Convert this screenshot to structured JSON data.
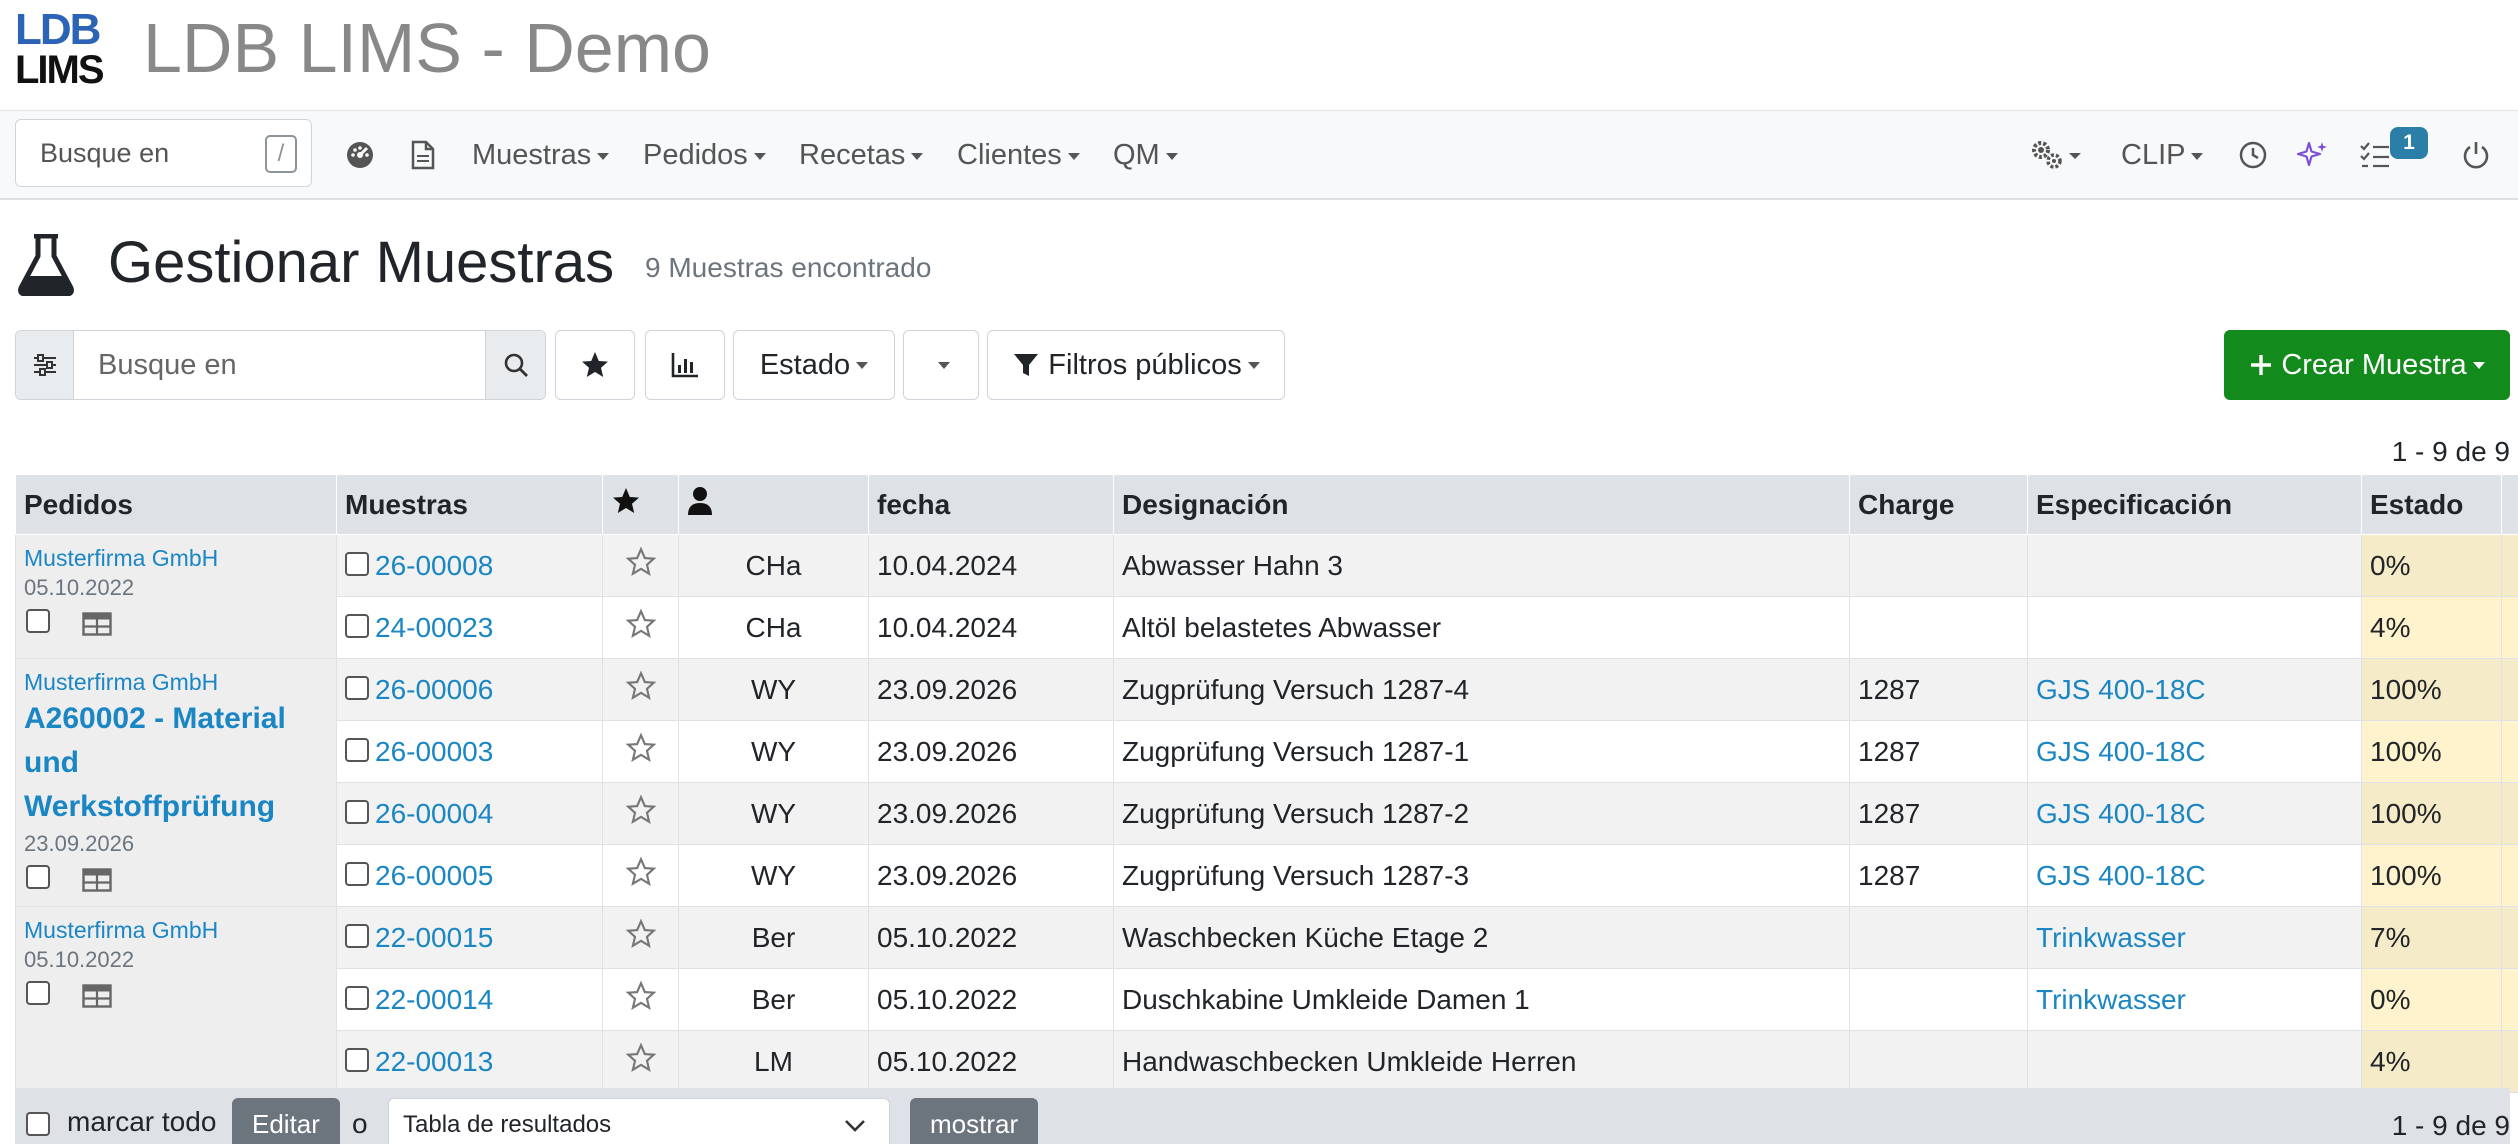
{
  "header": {
    "logo_line1": "LDB",
    "logo_line2": "LIMS",
    "title": "LDB LIMS - Demo"
  },
  "navbar": {
    "search_placeholder": "Busque en",
    "search_shortcut": "/",
    "menus": [
      "Muestras",
      "Pedidos",
      "Recetas",
      "Clientes",
      "QM"
    ],
    "right_menu": "CLIP",
    "tasks_badge": "1"
  },
  "page": {
    "title": "Gestionar Muestras",
    "count": "9 Muestras encontrado"
  },
  "toolbar": {
    "search_placeholder": "Busque en",
    "estado_label": "Estado",
    "public_filters_label": "Filtros públicos",
    "create_label": "Crear Muestra"
  },
  "pager": {
    "top": "1 - 9 de 9",
    "bottom": "1 - 9 de 9"
  },
  "table": {
    "columns": [
      "Pedidos",
      "Muestras",
      "",
      "",
      "fecha",
      "Designación",
      "Charge",
      "Especificación",
      "Estado",
      ""
    ],
    "groups": [
      {
        "client": "Musterfirma GmbH",
        "title": "",
        "date": "05.10.2022"
      },
      {
        "client": "Musterfirma GmbH",
        "title": "A260002 - Material und Werkstoffprüfung",
        "date": "23.09.2026"
      },
      {
        "client": "Musterfirma GmbH",
        "title": "",
        "date": "05.10.2022"
      }
    ],
    "rows": [
      {
        "id": "26-00008",
        "user": "CHa",
        "date": "10.04.2024",
        "designation": "Abwasser Hahn 3",
        "charge": "",
        "spec": "",
        "state": "0%",
        "icon": "truck-icon"
      },
      {
        "id": "24-00023",
        "user": "CHa",
        "date": "10.04.2024",
        "designation": "Altöl belastetes Abwasser",
        "charge": "",
        "spec": "",
        "state": "4%",
        "icon": "truck-icon"
      },
      {
        "id": "26-00006",
        "user": "WY",
        "date": "23.09.2026",
        "designation": "Zugprüfung Versuch 1287-4",
        "charge": "1287",
        "spec": "GJS 400-18C",
        "state": "100%",
        "icon": "report-icon"
      },
      {
        "id": "26-00003",
        "user": "WY",
        "date": "23.09.2026",
        "designation": "Zugprüfung Versuch 1287-1",
        "charge": "1287",
        "spec": "GJS 400-18C",
        "state": "100%",
        "icon": "report-icon"
      },
      {
        "id": "26-00004",
        "user": "WY",
        "date": "23.09.2026",
        "designation": "Zugprüfung Versuch 1287-2",
        "charge": "1287",
        "spec": "GJS 400-18C",
        "state": "100%",
        "icon": "report-icon"
      },
      {
        "id": "26-00005",
        "user": "WY",
        "date": "23.09.2026",
        "designation": "Zugprüfung Versuch 1287-3",
        "charge": "1287",
        "spec": "GJS 400-18C",
        "state": "100%",
        "icon": "report-icon"
      },
      {
        "id": "22-00015",
        "user": "Ber",
        "date": "05.10.2022",
        "designation": "Waschbecken Küche Etage 2",
        "charge": "",
        "spec": "Trinkwasser",
        "state": "7%",
        "icon": "home-icon"
      },
      {
        "id": "22-00014",
        "user": "Ber",
        "date": "05.10.2022",
        "designation": "Duschkabine Umkleide Damen 1",
        "charge": "",
        "spec": "Trinkwasser",
        "state": "0%",
        "icon": "home-icon"
      },
      {
        "id": "22-00013",
        "user": "LM",
        "date": "05.10.2022",
        "designation": "Handwaschbecken Umkleide Herren",
        "charge": "",
        "spec": "",
        "state": "4%",
        "icon": "home-icon"
      }
    ]
  },
  "footer": {
    "mark_all": "marcar todo",
    "edit_label": "Editar",
    "or": "o",
    "select_value": "Tabla de resultados",
    "show_label": "mostrar"
  },
  "colors": {
    "link": "#1a86c4",
    "primary_green": "#138a1c",
    "state_bg": "#fff3cd",
    "report_orange": "#f0a020",
    "truck_green": "#1a9a1a"
  }
}
